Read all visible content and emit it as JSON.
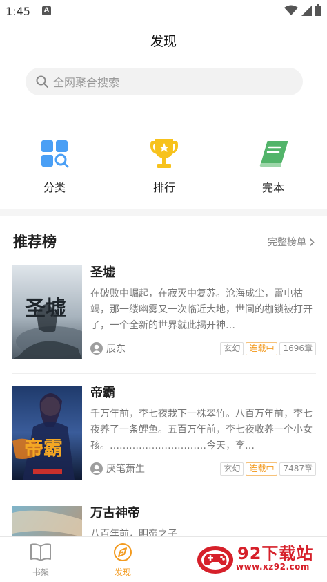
{
  "status_bar": {
    "time": "1:45",
    "notification_icon": "A"
  },
  "header": {
    "title": "发现"
  },
  "search": {
    "placeholder": "全网聚合搜索"
  },
  "quick_nav": [
    {
      "label": "分类",
      "icon": "category-grid-search-icon",
      "color": "#4a9ff5"
    },
    {
      "label": "排行",
      "icon": "trophy-icon",
      "color": "#f7c21c"
    },
    {
      "label": "完本",
      "icon": "book-icon",
      "color": "#52b46a"
    }
  ],
  "recommend": {
    "title": "推荐榜",
    "more_label": "完整榜单",
    "books": [
      {
        "title": "圣墟",
        "description": "在破败中崛起，在寂灭中复苏。沧海成尘，雷电枯竭，那一缕幽雾又一次临近大地，世间的枷锁被打开了，一个全新的世界就此揭开神…",
        "author": "辰东",
        "genre": "玄幻",
        "status": "连载中",
        "chapters": "1696章",
        "cover_text": "圣墟"
      },
      {
        "title": "帝霸",
        "description": "千万年前，李七夜栽下一株翠竹。八百万年前，李七夜养了一条鲤鱼。五百万年前，李七夜收养一个小女孩。…………………………今天，李…",
        "author": "厌笔萧生",
        "genre": "玄幻",
        "status": "连载中",
        "chapters": "7487章",
        "cover_text": "帝霸"
      },
      {
        "title": "万古神帝",
        "description": "八百年前，明帝之子…",
        "author": "",
        "genre": "",
        "status": "",
        "chapters": "",
        "cover_text": ""
      }
    ]
  },
  "tab_bar": [
    {
      "label": "书架",
      "icon": "book-open-icon",
      "active": false
    },
    {
      "label": "发现",
      "icon": "compass-icon",
      "active": true
    }
  ],
  "watermark": {
    "text": "92下载站",
    "url": "www.xz92.com"
  },
  "colors": {
    "accent": "#f39a1e",
    "text_primary": "#222222",
    "text_secondary": "#777777"
  }
}
